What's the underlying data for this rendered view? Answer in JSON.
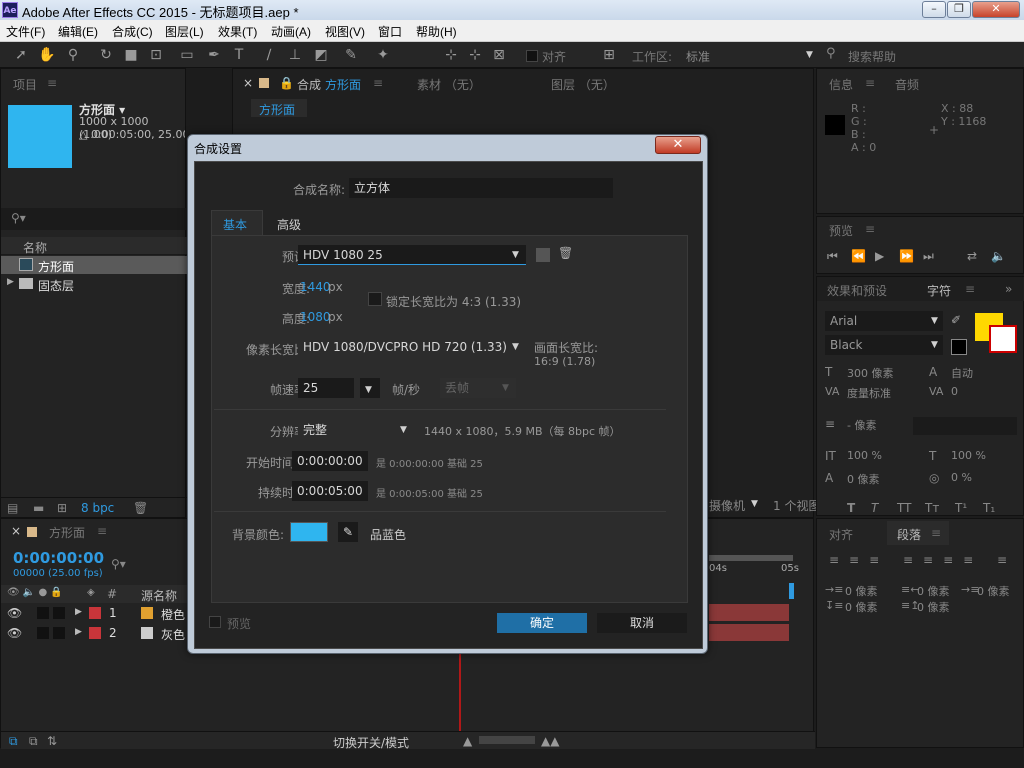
{
  "window": {
    "title": "Adobe After Effects CC 2015 - 无标题项目.aep *",
    "logo": "Ae"
  },
  "menu": [
    "文件(F)",
    "编辑(E)",
    "合成(C)",
    "图层(L)",
    "效果(T)",
    "动画(A)",
    "视图(V)",
    "窗口",
    "帮助(H)"
  ],
  "toolbar": {
    "align_label": "对齐",
    "workspace_label": "工作区:",
    "workspace_value": "标准",
    "search_placeholder": "搜索帮助"
  },
  "project": {
    "tab": "项目",
    "item_name": "方形面 ▾",
    "item_size": "1000 x 1000 (1.00)",
    "item_duration": "△ 0:00:05:00, 25.00 fps",
    "swatch_color": "#2fb5ef",
    "col_name": "名称",
    "rows": [
      "方形面",
      "固态层"
    ],
    "bpc": "8 bpc"
  },
  "comp_viewer": {
    "close": "×",
    "tab_prefix": "合成",
    "tab_name": "方形面",
    "footage_tab": "素材 （无）",
    "layer_tab": "图层 （无）",
    "sub_tab": "方形面",
    "camera": "1 个视图",
    "camera_mode": "摄像机"
  },
  "info": {
    "tab1": "信息",
    "tab2": "音频",
    "r": "R :",
    "g": "G :",
    "b": "B :",
    "a": "A : 0",
    "x": "X : 88",
    "y": "Y : 1168"
  },
  "preview": {
    "tab": "预览"
  },
  "effects": {
    "tab1": "效果和预设",
    "tab2": "字符"
  },
  "character": {
    "font": "Arial",
    "style": "Black",
    "size": "300 像素",
    "leading": "自动",
    "kerning": "度量标准",
    "tracking": "0",
    "stroke": "- 像素",
    "vscale": "100 %",
    "hscale": "100 %",
    "baseline": "0 像素",
    "tsume": "0 %",
    "fill_color": "#ffd800",
    "glyphs": [
      "T",
      "T",
      "TT",
      "Tт",
      "T¹",
      "T₁"
    ]
  },
  "paragraph": {
    "tab1": "对齐",
    "tab2": "段落",
    "indent1": "0 像素",
    "indent2": "0 像素",
    "indent3": "0 像素",
    "indent4": "0 像素",
    "indent5": "0 像素"
  },
  "timeline": {
    "tab": "方形面",
    "timecode": "0:00:00:00",
    "frames": "00000 (25.00 fps)",
    "col_source": "源名称",
    "layers": [
      {
        "num": "1",
        "name": "橙色",
        "label_color": "#e0a030"
      },
      {
        "num": "2",
        "name": "灰色",
        "label_color": "#cccccc"
      }
    ],
    "ruler": [
      "04s",
      "05s"
    ],
    "footer": "切换开关/模式"
  },
  "dialog": {
    "title": "合成设置",
    "close": "✕",
    "name_label": "合成名称:",
    "name_value": "立方体",
    "tab_basic": "基本",
    "tab_advanced": "高级",
    "preset_label": "预设:",
    "preset_value": "HDV 1080 25",
    "width_label": "宽度:",
    "width_value": "1440",
    "width_unit": "px",
    "lock_label": "锁定长宽比为 4:3 (1.33)",
    "height_label": "高度:",
    "height_value": "1080",
    "height_unit": "px",
    "par_label": "像素长宽比:",
    "par_value": "HDV 1080/DVCPRO HD 720 (1.33)",
    "frame_aspect_label": "画面长宽比:",
    "frame_aspect_value": "16:9 (1.78)",
    "fps_label": "帧速率:",
    "fps_value": "25",
    "fps_unit": "帧/秒",
    "drop_frame": "丢帧",
    "res_label": "分辨率:",
    "res_value": "完整",
    "res_info": "1440 x 1080，5.9 MB（每 8bpc 帧）",
    "start_label": "开始时间码:",
    "start_value": "0:00:00:00",
    "start_note": "是 0:00:00:00  基础 25",
    "dur_label": "持续时间:",
    "dur_value": "0:00:05:00",
    "dur_note": "是 0:00:05:00  基础 25",
    "bg_label": "背景颜色:",
    "bg_color": "#2fb5ef",
    "bg_name": "品蓝色",
    "preview_label": "预览",
    "ok": "确定",
    "cancel": "取消"
  }
}
